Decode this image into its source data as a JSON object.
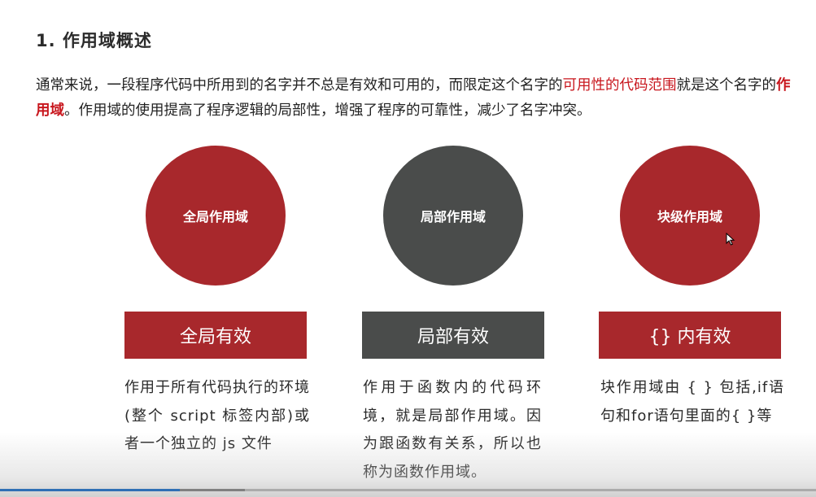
{
  "heading": "1. 作用域概述",
  "intro": {
    "part1": "通常来说，一段程序代码中所用到的名字并不总是有效和可用的，而限定这个名字的",
    "highlight1": "可用性的代码范围",
    "part2": "就是这个名字的",
    "highlight2": "作用域",
    "part3": "。作用域的使用提高了程序逻辑的局部性，增强了程序的可靠性，减少了名字冲突。"
  },
  "scopes": [
    {
      "circle_label": "全局作用域",
      "banner_label": "全局有效",
      "description": "作用于所有代码执行的环境(整个 script 标签内部)或者一个独立的 js 文件"
    },
    {
      "circle_label": "局部作用域",
      "banner_label": "局部有效",
      "description": "作用于函数内的代码环境，就是局部作用域。因为跟函数有关系，所以也称为函数作用域。"
    },
    {
      "circle_label": "块级作用域",
      "banner_label": "{} 内有效",
      "description": "块作用域由 { } 包括,if语句和for语句里面的{ }等"
    }
  ],
  "colors": {
    "accent_red": "#a8282c",
    "dark_gray": "#4a4c4b",
    "highlight_text": "#c8161d",
    "progress": "#2f6fb5"
  },
  "cursor_icon": "pointer-arrow-icon",
  "video_progress": {
    "played_fraction": 0.22,
    "buffered_fraction": 0.3
  }
}
